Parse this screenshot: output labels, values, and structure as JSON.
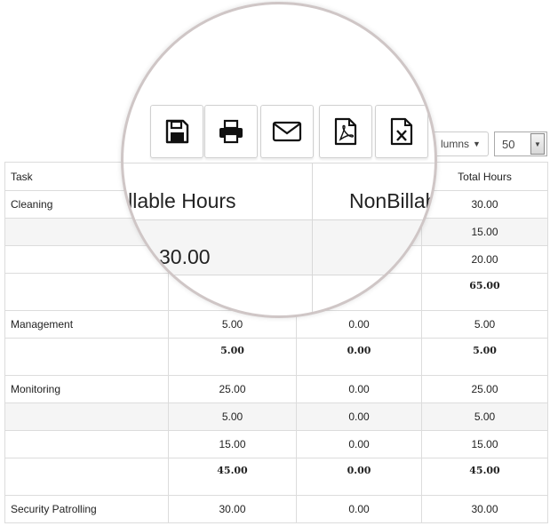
{
  "toolbar": {
    "buttons": [
      {
        "name": "save-button",
        "icon": "floppy-disk-icon"
      },
      {
        "name": "print-button",
        "icon": "printer-icon"
      },
      {
        "name": "email-button",
        "icon": "envelope-icon"
      },
      {
        "name": "export-pdf-button",
        "icon": "pdf-file-icon"
      },
      {
        "name": "export-excel-button",
        "icon": "excel-file-icon"
      }
    ],
    "columns_label": "lumns",
    "page_size": "50"
  },
  "lens": {
    "billable_header": "illable Hours",
    "nonbillable_header": "NonBillab",
    "value": "30.00"
  },
  "table": {
    "headers": [
      "Task",
      "",
      "",
      "Total Hours"
    ],
    "rows": [
      {
        "task": "Cleaning",
        "billable": "",
        "nonbillable": "",
        "total": "30.00",
        "type": "data"
      },
      {
        "task": "",
        "billable": "",
        "nonbillable": "",
        "total": "15.00",
        "type": "data-alt"
      },
      {
        "task": "",
        "billable": "",
        "nonbillable": "",
        "total": "20.00",
        "type": "data"
      },
      {
        "task": "",
        "billable": "",
        "nonbillable": "",
        "total": "65.00",
        "type": "total"
      },
      {
        "task": "Management",
        "billable": "5.00",
        "nonbillable": "0.00",
        "total": "5.00",
        "type": "data"
      },
      {
        "task": "",
        "billable": "5.00",
        "nonbillable": "0.00",
        "total": "5.00",
        "type": "total"
      },
      {
        "task": "Monitoring",
        "billable": "25.00",
        "nonbillable": "0.00",
        "total": "25.00",
        "type": "data"
      },
      {
        "task": "",
        "billable": "5.00",
        "nonbillable": "0.00",
        "total": "5.00",
        "type": "data-alt"
      },
      {
        "task": "",
        "billable": "15.00",
        "nonbillable": "0.00",
        "total": "15.00",
        "type": "data"
      },
      {
        "task": "",
        "billable": "45.00",
        "nonbillable": "0.00",
        "total": "45.00",
        "type": "total"
      },
      {
        "task": "Security Patrolling",
        "billable": "30.00",
        "nonbillable": "0.00",
        "total": "30.00",
        "type": "data"
      }
    ]
  },
  "colors": {
    "border": "#dcdcdc",
    "alt_row": "#f5f5f5",
    "lens_ring": "#cfc6c6"
  }
}
